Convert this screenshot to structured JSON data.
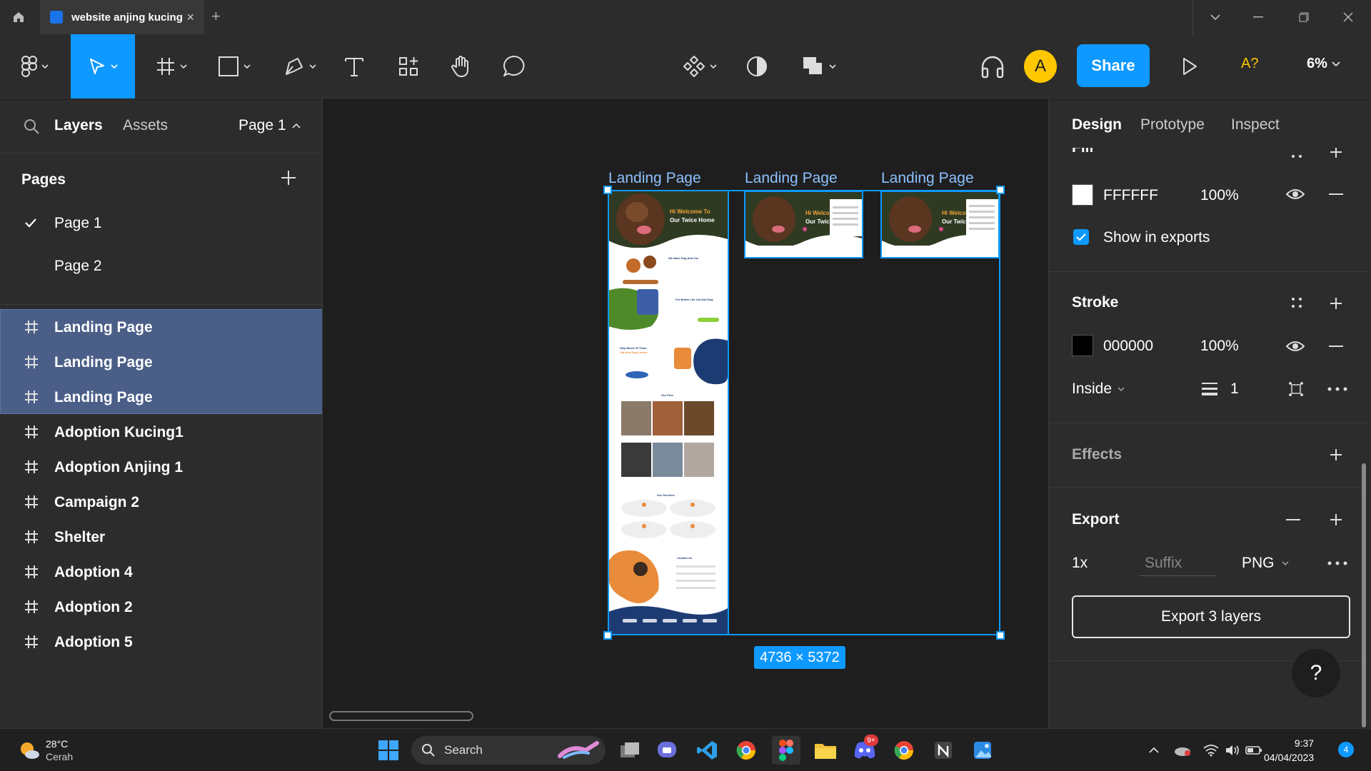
{
  "tabbar": {
    "tab_title": "website anjing kucing",
    "new_tab_symbol": "+",
    "close_symbol": "×"
  },
  "toolbar": {
    "share_label": "Share",
    "avatar_initial": "A",
    "a_question": "A?",
    "zoom_value": "6%"
  },
  "left_panel": {
    "tabs": {
      "layers": "Layers",
      "assets": "Assets"
    },
    "current_page": "Page 1",
    "pages_title": "Pages",
    "pages": [
      {
        "label": "Page 1",
        "active": true
      },
      {
        "label": "Page 2",
        "active": false
      }
    ],
    "layers": [
      {
        "label": "Landing Page",
        "selected": true
      },
      {
        "label": "Landing Page",
        "selected": true
      },
      {
        "label": "Landing Page",
        "selected": true
      },
      {
        "label": "Adoption Kucing1",
        "selected": false
      },
      {
        "label": "Adoption Anjing 1",
        "selected": false
      },
      {
        "label": "Campaign 2",
        "selected": false
      },
      {
        "label": "Shelter",
        "selected": false
      },
      {
        "label": "Adoption 4",
        "selected": false
      },
      {
        "label": "Adoption 2",
        "selected": false
      },
      {
        "label": "Adoption 5",
        "selected": false
      }
    ]
  },
  "canvas": {
    "frame_labels": [
      "Landing Page",
      "Landing Page",
      "Landing Page"
    ],
    "selection_size": "4736 × 5372",
    "mockup": {
      "hero_line1": "Hi Welcome To",
      "hero_line2": "Our Twice Home",
      "hero_short1": "Hi Welco",
      "hero_short2": "Our Twic",
      "sec_dog_cat": "We Have Dog And Cat",
      "sec_better_life": "For Better Life Cat And Dog",
      "sec_help": "Help Much Of Them",
      "sec_help2": "Cat And Dog Lovers",
      "sec_pets": "Our Pets",
      "sec_services": "Our Services",
      "sec_contact": "Contact Us"
    }
  },
  "right_panel": {
    "tabs": {
      "design": "Design",
      "prototype": "Prototype",
      "inspect": "Inspect"
    },
    "fill": {
      "title_partial": "Fill",
      "hex": "FFFFFF",
      "opacity": "100%",
      "color": "#ffffff",
      "show_in_exports": "Show in exports"
    },
    "stroke": {
      "title": "Stroke",
      "hex": "000000",
      "opacity": "100%",
      "color": "#000000",
      "position": "Inside",
      "weight": "1"
    },
    "effects": {
      "title": "Effects"
    },
    "export": {
      "title": "Export",
      "scale": "1x",
      "suffix_placeholder": "Suffix",
      "format": "PNG",
      "button": "Export 3 layers"
    },
    "help": "?"
  },
  "taskbar": {
    "weather_temp": "28°C",
    "weather_desc": "Cerah",
    "search_label": "Search",
    "time": "9:37",
    "date": "04/04/2023",
    "notification_count": "4",
    "discord_badge": "9+"
  },
  "colors": {
    "accent": "#0d99ff",
    "selection": "#4a5e88",
    "avatar": "#ffc700"
  }
}
